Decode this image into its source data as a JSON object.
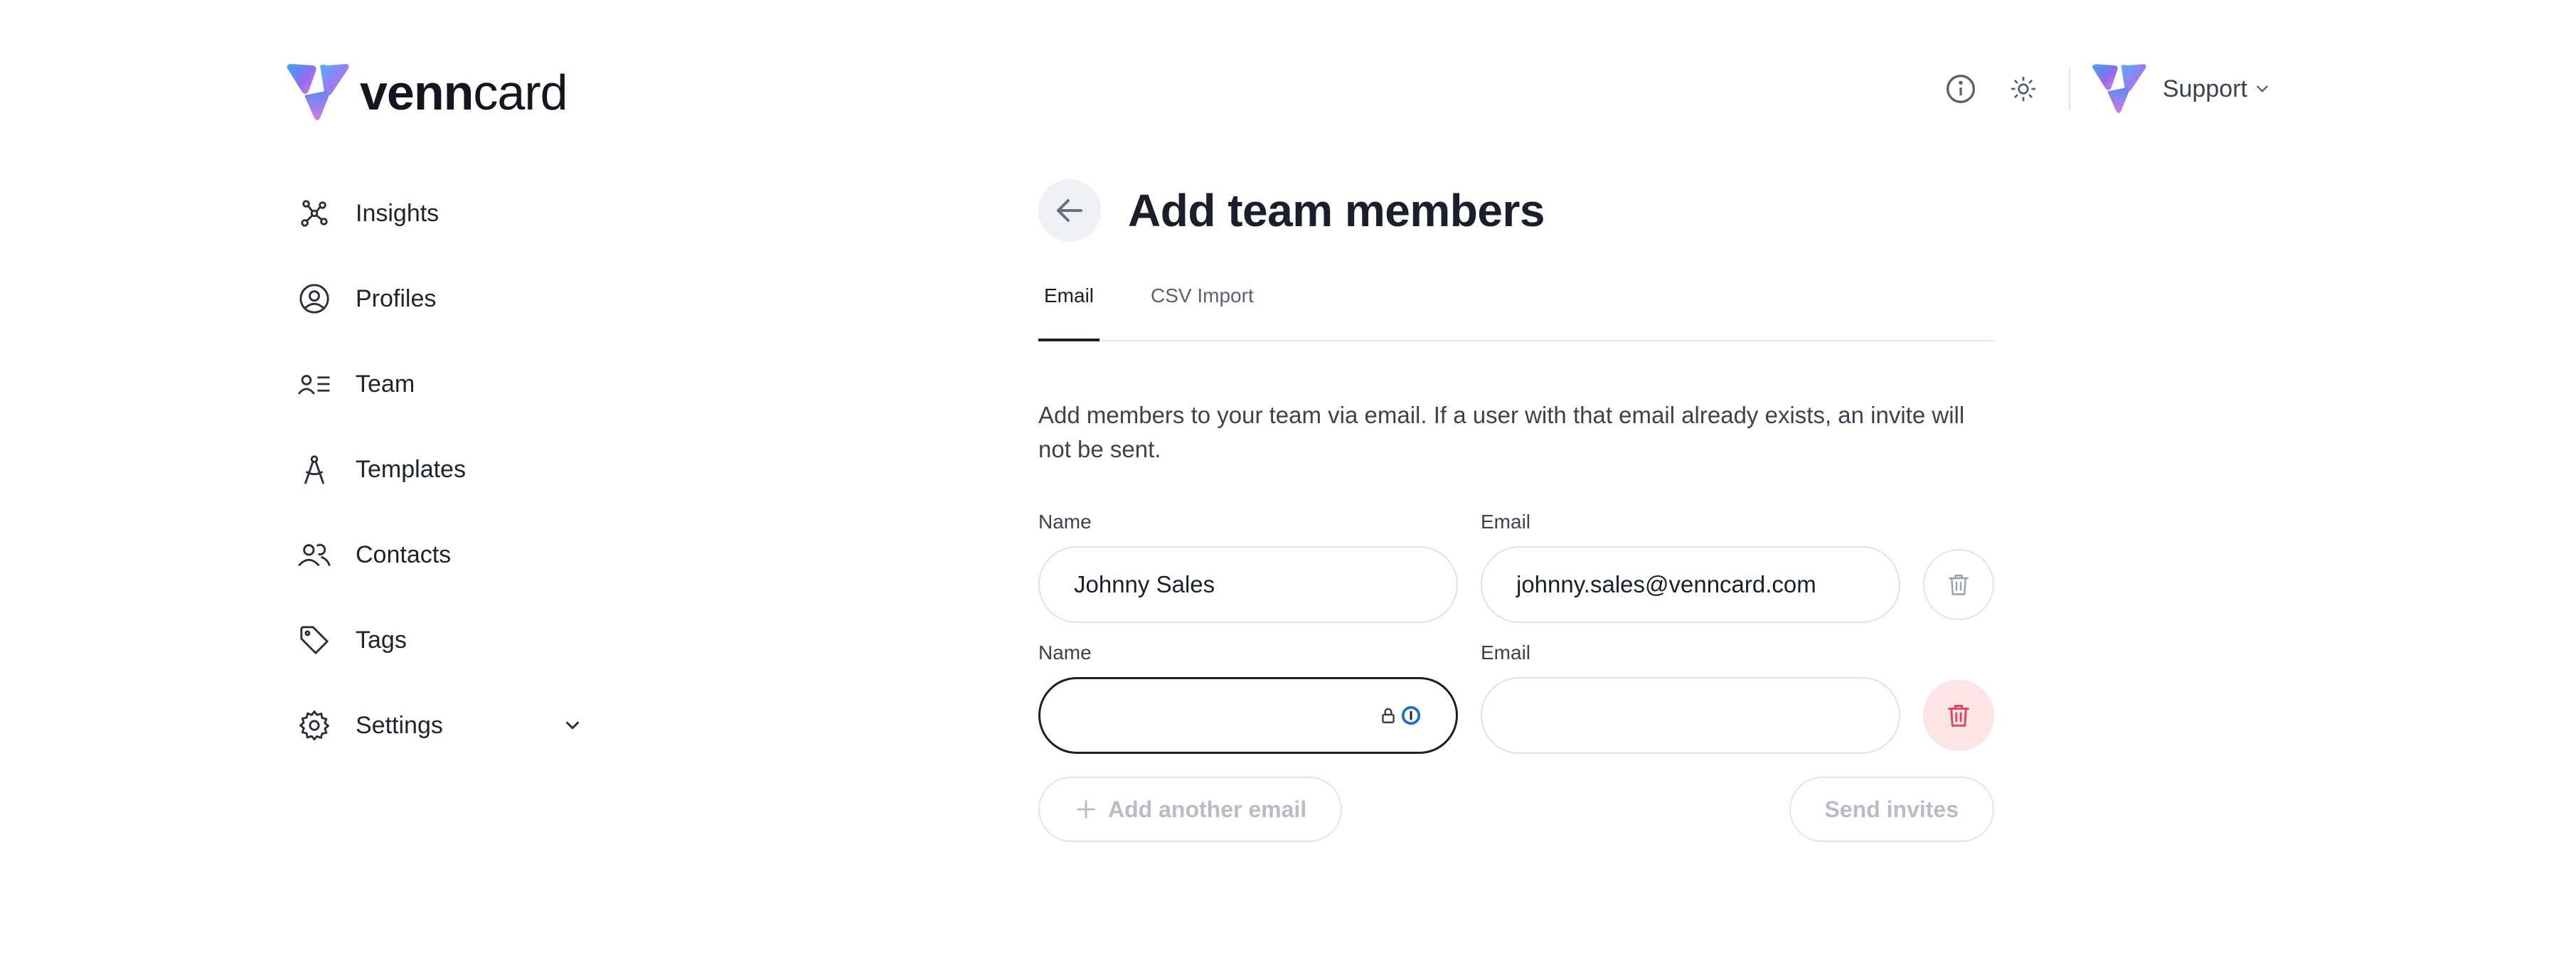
{
  "brand": {
    "name_bold": "venn",
    "name_light": "card",
    "gradient": [
      "#3aa8f5",
      "#8f6cf0",
      "#e57be0"
    ]
  },
  "header": {
    "info_icon": "info-circle-icon",
    "theme_icon": "sun-icon",
    "account_label": "Support"
  },
  "sidebar": {
    "items": [
      {
        "label": "Insights",
        "icon": "graph-nodes-icon"
      },
      {
        "label": "Profiles",
        "icon": "user-circle-icon"
      },
      {
        "label": "Team",
        "icon": "user-list-icon"
      },
      {
        "label": "Templates",
        "icon": "compass-icon"
      },
      {
        "label": "Contacts",
        "icon": "users-icon"
      },
      {
        "label": "Tags",
        "icon": "tag-icon"
      },
      {
        "label": "Settings",
        "icon": "gear-icon",
        "expandable": true
      }
    ]
  },
  "main": {
    "title": "Add team members",
    "tabs": [
      {
        "label": "Email",
        "active": true
      },
      {
        "label": "CSV Import",
        "active": false
      }
    ],
    "description": "Add members to your team via email. If a user with that email already exists, an invite will not be sent.",
    "rows": [
      {
        "name_label": "Name",
        "email_label": "Email",
        "name_value": "Johnny Sales",
        "email_value": "johnny.sales@venncard.com"
      },
      {
        "name_label": "Name",
        "email_label": "Email",
        "name_value": "",
        "email_value": ""
      }
    ],
    "add_another_label": "Add another email",
    "send_label": "Send invites"
  },
  "colors": {
    "text": "#1b1f2c",
    "muted": "#b8bcc6",
    "danger": "#e0445a",
    "danger_bg": "#fde4e7"
  }
}
